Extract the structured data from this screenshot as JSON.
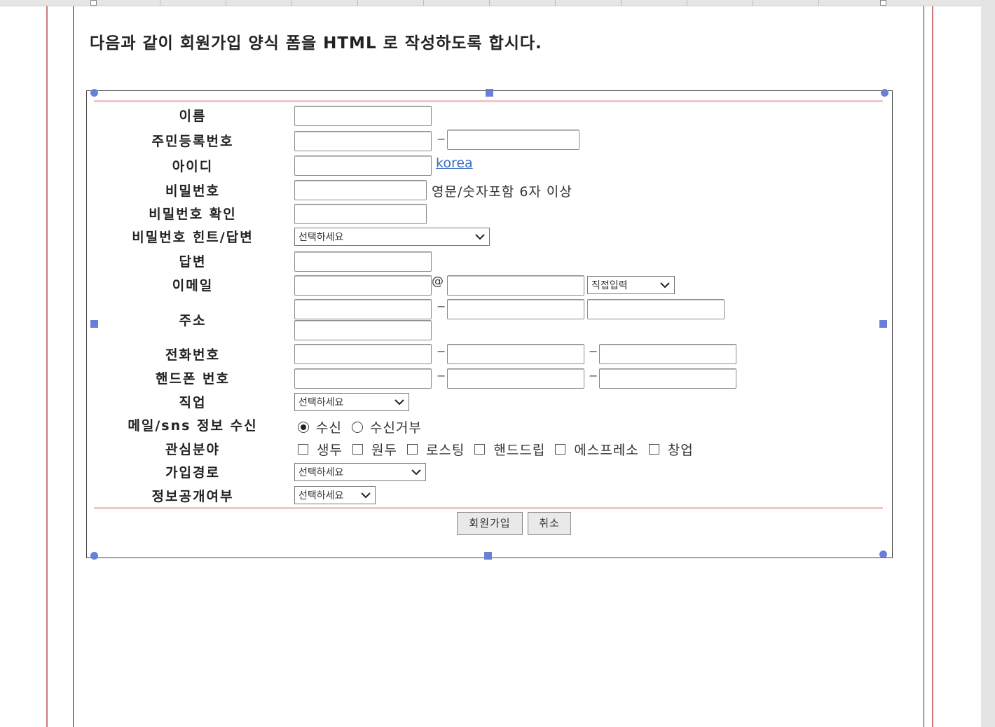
{
  "heading": "다음과 같이 회원가입 양식 폼을 HTML 로 작성하도록 합시다.",
  "labels": {
    "name": "이름",
    "rrn": "주민등록번호",
    "userid": "아이디",
    "password": "비밀번호",
    "password_confirm": "비밀번호 확인",
    "hint": "비밀번호 힌트/답변",
    "answer": "답변",
    "email": "이메일",
    "address": "주소",
    "phone": "전화번호",
    "mobile": "핸드폰 번호",
    "job": "직업",
    "mail_sns": "메일/sns 정보 수신",
    "interest": "관심분야",
    "join_route": "가입경로",
    "disclosure": "정보공개여부"
  },
  "userid_link": "korea",
  "password_hint_text": "영문/숫자포함 6자 이상",
  "email_at": "@",
  "dash": "−",
  "selects": {
    "hint": "선택하세요",
    "email_domain": "직접입력",
    "job": "선택하세요",
    "join_route": "선택하세요",
    "disclosure": "선택하세요"
  },
  "mail_sns_options": [
    {
      "label": "수신",
      "checked": true
    },
    {
      "label": "수신거부",
      "checked": false
    }
  ],
  "interest_options": [
    "생두",
    "원두",
    "로스팅",
    "핸드드립",
    "에스프레소",
    "창업"
  ],
  "buttons": {
    "submit": "회원가입",
    "cancel": "취소"
  },
  "colors": {
    "handle": "#6a7fd6",
    "margin_line": "#c9797a",
    "pink_rule": "#f4c6c8",
    "link": "#3b6fc4"
  }
}
